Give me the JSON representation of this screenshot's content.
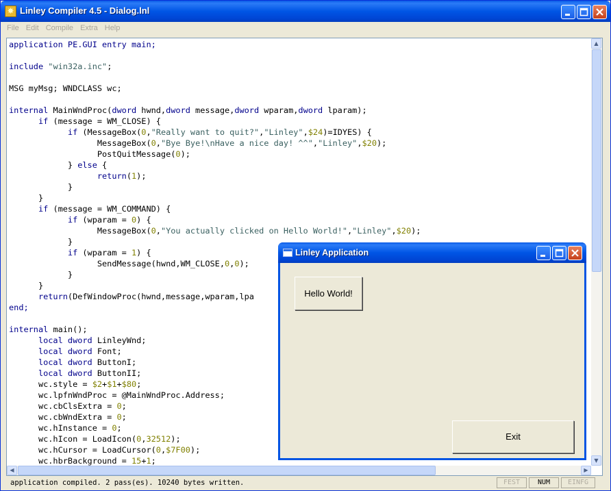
{
  "main_window": {
    "title": "Linley Compiler 4.5 - Dialog.lnl",
    "menu": [
      "File",
      "Edit",
      "Compile",
      "Extra",
      "Help"
    ]
  },
  "editor": {
    "lines": [
      [
        {
          "t": "application PE.GUI entry main;",
          "c": "kw"
        }
      ],
      [],
      [
        {
          "t": "include ",
          "c": "kw"
        },
        {
          "t": "\"win32a.inc\"",
          "c": "str"
        },
        {
          "t": ";"
        }
      ],
      [],
      [
        {
          "t": "MSG myMsg; WNDCLASS wc;"
        }
      ],
      [],
      [
        {
          "t": "internal ",
          "c": "kw"
        },
        {
          "t": "MainWndProc("
        },
        {
          "t": "dword ",
          "c": "kw"
        },
        {
          "t": "hwnd,"
        },
        {
          "t": "dword ",
          "c": "kw"
        },
        {
          "t": "message,"
        },
        {
          "t": "dword ",
          "c": "kw"
        },
        {
          "t": "wparam,"
        },
        {
          "t": "dword ",
          "c": "kw"
        },
        {
          "t": "lparam);"
        }
      ],
      [
        {
          "t": "      "
        },
        {
          "t": "if ",
          "c": "kw"
        },
        {
          "t": "(message = WM_CLOSE) {"
        }
      ],
      [
        {
          "t": "            "
        },
        {
          "t": "if ",
          "c": "kw"
        },
        {
          "t": "(MessageBox("
        },
        {
          "t": "0",
          "c": "num"
        },
        {
          "t": ","
        },
        {
          "t": "\"Really want to quit?\"",
          "c": "str"
        },
        {
          "t": ","
        },
        {
          "t": "\"Linley\"",
          "c": "str"
        },
        {
          "t": ","
        },
        {
          "t": "$24",
          "c": "num"
        },
        {
          "t": ")=IDYES) {"
        }
      ],
      [
        {
          "t": "                  MessageBox("
        },
        {
          "t": "0",
          "c": "num"
        },
        {
          "t": ","
        },
        {
          "t": "\"Bye Bye!\\nHave a nice day! ^^\"",
          "c": "str"
        },
        {
          "t": ","
        },
        {
          "t": "\"Linley\"",
          "c": "str"
        },
        {
          "t": ","
        },
        {
          "t": "$20",
          "c": "num"
        },
        {
          "t": ");"
        }
      ],
      [
        {
          "t": "                  PostQuitMessage("
        },
        {
          "t": "0",
          "c": "num"
        },
        {
          "t": ");"
        }
      ],
      [
        {
          "t": "            } "
        },
        {
          "t": "else ",
          "c": "kw"
        },
        {
          "t": "{"
        }
      ],
      [
        {
          "t": "                  "
        },
        {
          "t": "return",
          "c": "kw"
        },
        {
          "t": "("
        },
        {
          "t": "1",
          "c": "num"
        },
        {
          "t": ");"
        }
      ],
      [
        {
          "t": "            }"
        }
      ],
      [
        {
          "t": "      }"
        }
      ],
      [
        {
          "t": "      "
        },
        {
          "t": "if ",
          "c": "kw"
        },
        {
          "t": "(message = WM_COMMAND) {"
        }
      ],
      [
        {
          "t": "            "
        },
        {
          "t": "if ",
          "c": "kw"
        },
        {
          "t": "(wparam = "
        },
        {
          "t": "0",
          "c": "num"
        },
        {
          "t": ") {"
        }
      ],
      [
        {
          "t": "                  MessageBox("
        },
        {
          "t": "0",
          "c": "num"
        },
        {
          "t": ","
        },
        {
          "t": "\"You actually clicked on Hello World!\"",
          "c": "str"
        },
        {
          "t": ","
        },
        {
          "t": "\"Linley\"",
          "c": "str"
        },
        {
          "t": ","
        },
        {
          "t": "$20",
          "c": "num"
        },
        {
          "t": ");"
        }
      ],
      [
        {
          "t": "            }"
        }
      ],
      [
        {
          "t": "            "
        },
        {
          "t": "if ",
          "c": "kw"
        },
        {
          "t": "(wparam = "
        },
        {
          "t": "1",
          "c": "num"
        },
        {
          "t": ") {"
        }
      ],
      [
        {
          "t": "                  SendMessage(hwnd,WM_CLOSE,"
        },
        {
          "t": "0",
          "c": "num"
        },
        {
          "t": ","
        },
        {
          "t": "0",
          "c": "num"
        },
        {
          "t": ");"
        }
      ],
      [
        {
          "t": "            }"
        }
      ],
      [
        {
          "t": "      }"
        }
      ],
      [
        {
          "t": "      "
        },
        {
          "t": "return",
          "c": "kw"
        },
        {
          "t": "(DefWindowProc(hwnd,message,wparam,lpa"
        }
      ],
      [
        {
          "t": "end;",
          "c": "kw"
        }
      ],
      [],
      [
        {
          "t": "internal ",
          "c": "kw"
        },
        {
          "t": "main();"
        }
      ],
      [
        {
          "t": "      "
        },
        {
          "t": "local dword ",
          "c": "kw"
        },
        {
          "t": "LinleyWnd;"
        }
      ],
      [
        {
          "t": "      "
        },
        {
          "t": "local dword ",
          "c": "kw"
        },
        {
          "t": "Font;"
        }
      ],
      [
        {
          "t": "      "
        },
        {
          "t": "local dword ",
          "c": "kw"
        },
        {
          "t": "ButtonI;"
        }
      ],
      [
        {
          "t": "      "
        },
        {
          "t": "local dword ",
          "c": "kw"
        },
        {
          "t": "ButtonII;"
        }
      ],
      [
        {
          "t": "      wc.style = "
        },
        {
          "t": "$2",
          "c": "num"
        },
        {
          "t": "+"
        },
        {
          "t": "$1",
          "c": "num"
        },
        {
          "t": "+"
        },
        {
          "t": "$80",
          "c": "num"
        },
        {
          "t": ";"
        }
      ],
      [
        {
          "t": "      wc.lpfnWndProc = @MainWndProc.Address;"
        }
      ],
      [
        {
          "t": "      wc.cbClsExtra = "
        },
        {
          "t": "0",
          "c": "num"
        },
        {
          "t": ";"
        }
      ],
      [
        {
          "t": "      wc.cbWndExtra = "
        },
        {
          "t": "0",
          "c": "num"
        },
        {
          "t": ";"
        }
      ],
      [
        {
          "t": "      wc.hInstance = "
        },
        {
          "t": "0",
          "c": "num"
        },
        {
          "t": ";"
        }
      ],
      [
        {
          "t": "      wc.hIcon = LoadIcon("
        },
        {
          "t": "0",
          "c": "num"
        },
        {
          "t": ","
        },
        {
          "t": "32512",
          "c": "num"
        },
        {
          "t": ");"
        }
      ],
      [
        {
          "t": "      wc.hCursor = LoadCursor("
        },
        {
          "t": "0",
          "c": "num"
        },
        {
          "t": ","
        },
        {
          "t": "$7F00",
          "c": "num"
        },
        {
          "t": ");"
        }
      ],
      [
        {
          "t": "      wc.hbrBackground = "
        },
        {
          "t": "15",
          "c": "num"
        },
        {
          "t": "+"
        },
        {
          "t": "1",
          "c": "num"
        },
        {
          "t": ";"
        }
      ]
    ]
  },
  "statusbar": {
    "message": "application compiled. 2 pass(es). 10240 bytes written.",
    "panels": [
      {
        "label": "FEST",
        "active": false
      },
      {
        "label": "NUM",
        "active": true
      },
      {
        "label": "EINFG",
        "active": false
      }
    ]
  },
  "dialog": {
    "title": "Linley Application",
    "hello_button": "Hello World!",
    "exit_button": "Exit"
  },
  "colors": {
    "titlebar": "#0055E5",
    "keyword": "#00008B",
    "string": "#3A6060",
    "number": "#808000",
    "window_bg": "#ECE9D8"
  },
  "icons": {
    "app": "compiler-star-icon",
    "minimize": "minimize-icon",
    "maximize": "maximize-icon",
    "close": "close-icon",
    "dialog": "window-icon"
  }
}
